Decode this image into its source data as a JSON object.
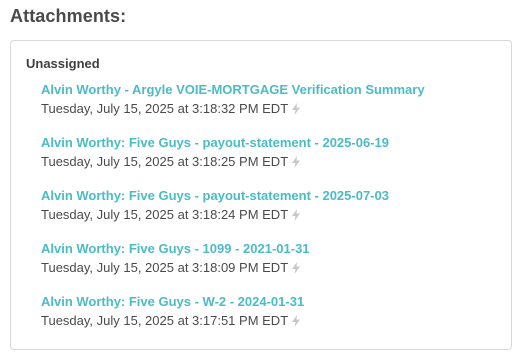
{
  "section": {
    "title": "Attachments:"
  },
  "group": {
    "label": "Unassigned"
  },
  "attachments": [
    {
      "name": "Alvin Worthy - Argyle VOIE-MORTGAGE Verification Summary",
      "timestamp": "Tuesday, July 15, 2025 at 3:18:32 PM EDT"
    },
    {
      "name": "Alvin Worthy: Five Guys - payout-statement - 2025-06-19",
      "timestamp": "Tuesday, July 15, 2025 at 3:18:25 PM EDT"
    },
    {
      "name": "Alvin Worthy: Five Guys - payout-statement - 2025-07-03",
      "timestamp": "Tuesday, July 15, 2025 at 3:18:24 PM EDT"
    },
    {
      "name": "Alvin Worthy: Five Guys - 1099 - 2021-01-31",
      "timestamp": "Tuesday, July 15, 2025 at 3:18:09 PM EDT"
    },
    {
      "name": "Alvin Worthy: Five Guys - W-2 - 2024-01-31",
      "timestamp": "Tuesday, July 15, 2025 at 3:17:51 PM EDT"
    }
  ],
  "icons": {
    "timestamp_suffix": "lightning-bolt-icon"
  },
  "colors": {
    "link": "#4bbcc4",
    "icon": "#c8c8c8",
    "border": "#d9d9d9"
  }
}
